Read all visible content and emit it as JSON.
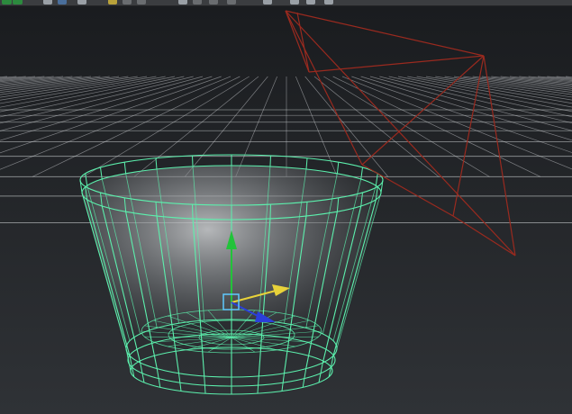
{
  "app": {
    "active_tool": "move",
    "selection": "cup-mesh"
  },
  "toolbar": {
    "buttons": [
      {
        "name": "layout-button-1",
        "icon": "layout-icon",
        "color": "#2c8a3e"
      },
      {
        "name": "layout-button-2",
        "icon": "layout-icon",
        "color": "#2c8a3e"
      },
      {
        "name": "select-mode-button",
        "icon": "select-icon",
        "color": "#9aa0a6"
      },
      {
        "name": "move-tool-button",
        "icon": "move-icon",
        "color": "#4a6f9c"
      },
      {
        "name": "rotate-tool-button",
        "icon": "rotate-icon",
        "color": "#9aa0a6"
      },
      {
        "name": "snap-grid-button",
        "icon": "grid-icon",
        "color": "#b9a23a"
      },
      {
        "name": "snap-curve-button",
        "icon": "curve-icon",
        "color": "#6a6d70"
      },
      {
        "name": "snap-point-button",
        "icon": "point-icon",
        "color": "#6a6d70"
      },
      {
        "name": "render-button",
        "icon": "render-icon",
        "color": "#9aa0a6"
      },
      {
        "name": "ipr-button",
        "icon": "render-icon",
        "color": "#6a6d70"
      },
      {
        "name": "camera-button",
        "icon": "camera-icon",
        "color": "#6a6d70"
      },
      {
        "name": "light-button",
        "icon": "light-icon",
        "color": "#6a6d70"
      },
      {
        "name": "history-button",
        "icon": "history-icon",
        "color": "#9aa0a6"
      },
      {
        "name": "sync-button",
        "icon": "refresh-icon",
        "color": "#9aa0a6"
      },
      {
        "name": "settings-button",
        "icon": "gear-icon",
        "color": "#9aa0a6"
      },
      {
        "name": "file-button",
        "icon": "file-icon",
        "color": "#9aa0a6"
      }
    ]
  },
  "colors": {
    "viewport_top": "#1a1c1f",
    "viewport_bottom": "#2f3236",
    "grid": "#d7dadd",
    "selection_wire": "#5cf0ad",
    "camera_wire": "#9a2a1f",
    "manip_y": "#22c33a",
    "manip_x": "#e8d23a",
    "manip_z": "#2b3fd9",
    "manip_center": "#5fc9ff"
  }
}
